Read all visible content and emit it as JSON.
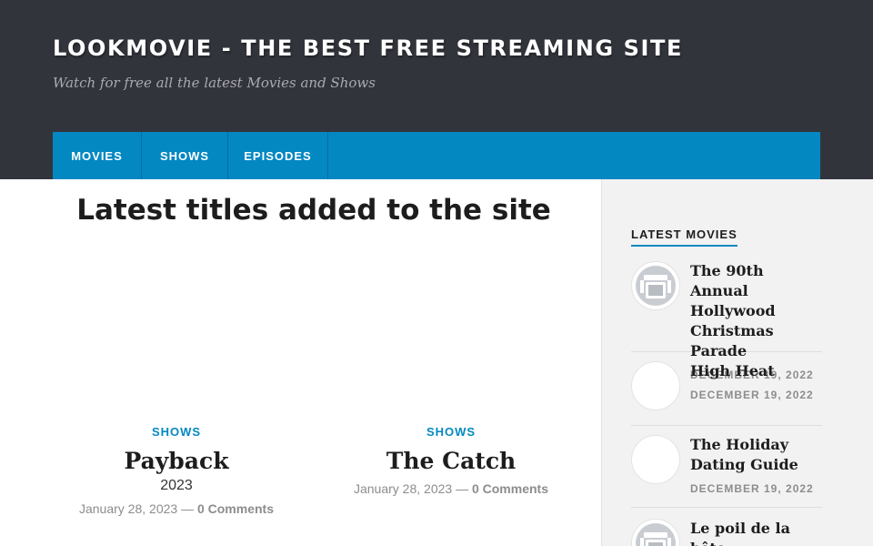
{
  "header": {
    "site_title": "LOOKMOVIE - THE BEST FREE STREAMING SITE",
    "tagline": "Watch for free all the latest Movies and Shows"
  },
  "nav": {
    "items": [
      {
        "label": "MOVIES"
      },
      {
        "label": "SHOWS"
      },
      {
        "label": "EPISODES"
      }
    ]
  },
  "main": {
    "title": "Latest titles added to the site",
    "posts": [
      {
        "category": "SHOWS",
        "title": "Payback",
        "year": "2023",
        "date": "January 28, 2023",
        "separator": "—",
        "comments": "0 Comments"
      },
      {
        "category": "SHOWS",
        "title": "The Catch",
        "date": "January 28, 2023",
        "separator": "—",
        "comments": "0 Comments"
      }
    ]
  },
  "sidebar": {
    "widget_title": "LATEST MOVIES",
    "items": [
      {
        "title": "The 90th Annual Hollywood Christmas Parade",
        "date": "DECEMBER 19, 2022",
        "thumb_icon": "film-placeholder-icon"
      },
      {
        "title": "High Heat",
        "date": "DECEMBER 19, 2022",
        "thumb_icon": "blank-thumbnail"
      },
      {
        "title": "The Holiday Dating Guide",
        "date": "DECEMBER 19, 2022",
        "thumb_icon": "blank-thumbnail"
      },
      {
        "title": "Le poil de la bête",
        "thumb_icon": "film-placeholder-icon"
      }
    ]
  },
  "colors": {
    "header_bg": "#32343b",
    "nav_bg": "#0388c2",
    "accent": "#0388c2",
    "sidebar_bg": "#f2f2f2",
    "meta_text": "#8d8d8d"
  }
}
